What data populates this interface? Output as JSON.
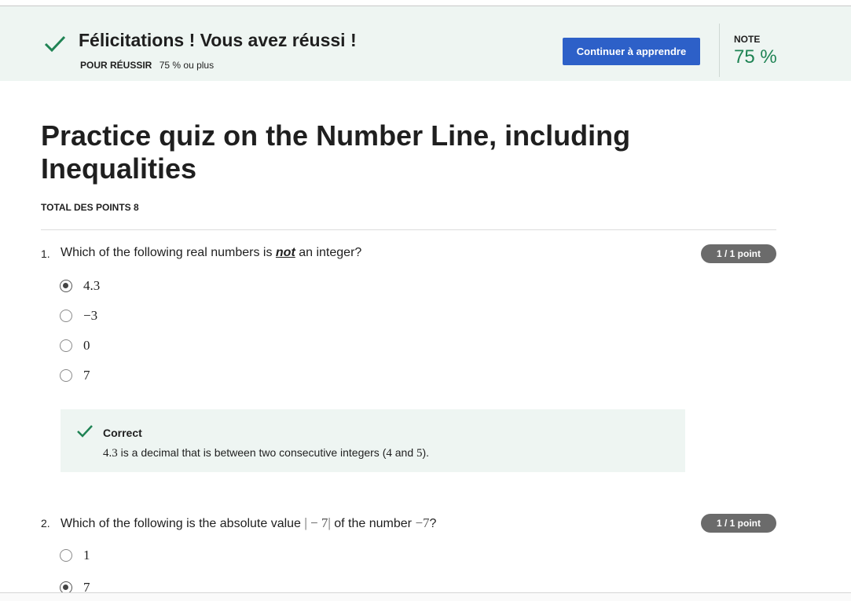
{
  "banner": {
    "title": "Félicitations ! Vous avez réussi !",
    "pass_label": "POUR RÉUSSIR",
    "pass_value": "75 % ou plus",
    "continue_label": "Continuer à apprendre",
    "grade_label": "NOTE",
    "grade_value": "75 %",
    "colors": {
      "background": "#eef5f2",
      "success": "#1f8354",
      "button": "#2d60c8"
    }
  },
  "quiz": {
    "title": "Practice quiz on the Number Line, including Inequalities",
    "total_points": "TOTAL DES POINTS 8"
  },
  "questions": [
    {
      "number": "1.",
      "text_before": "Which of the following real numbers is ",
      "text_em": "not",
      "text_after": " an integer?",
      "score": "1 / 1 point",
      "options": [
        {
          "label": "4.3",
          "selected": true
        },
        {
          "label": "−3",
          "selected": false
        },
        {
          "label": "0",
          "selected": false
        },
        {
          "label": "7",
          "selected": false
        }
      ],
      "feedback": {
        "title": "Correct",
        "math_1": "4.3",
        "text_1": " is a decimal that is between two consecutive integers (",
        "math_2": "4",
        "text_2": " and ",
        "math_3": "5",
        "text_3": ")."
      }
    },
    {
      "number": "2.",
      "text_before": "Which of the following is the absolute value ",
      "math_1": "| − 7|",
      "text_middle": " of the number ",
      "math_2": "−7",
      "text_after": "?",
      "score": "1 / 1 point",
      "options": [
        {
          "label": "1",
          "selected": false
        },
        {
          "label": "7",
          "selected": true
        }
      ]
    }
  ]
}
